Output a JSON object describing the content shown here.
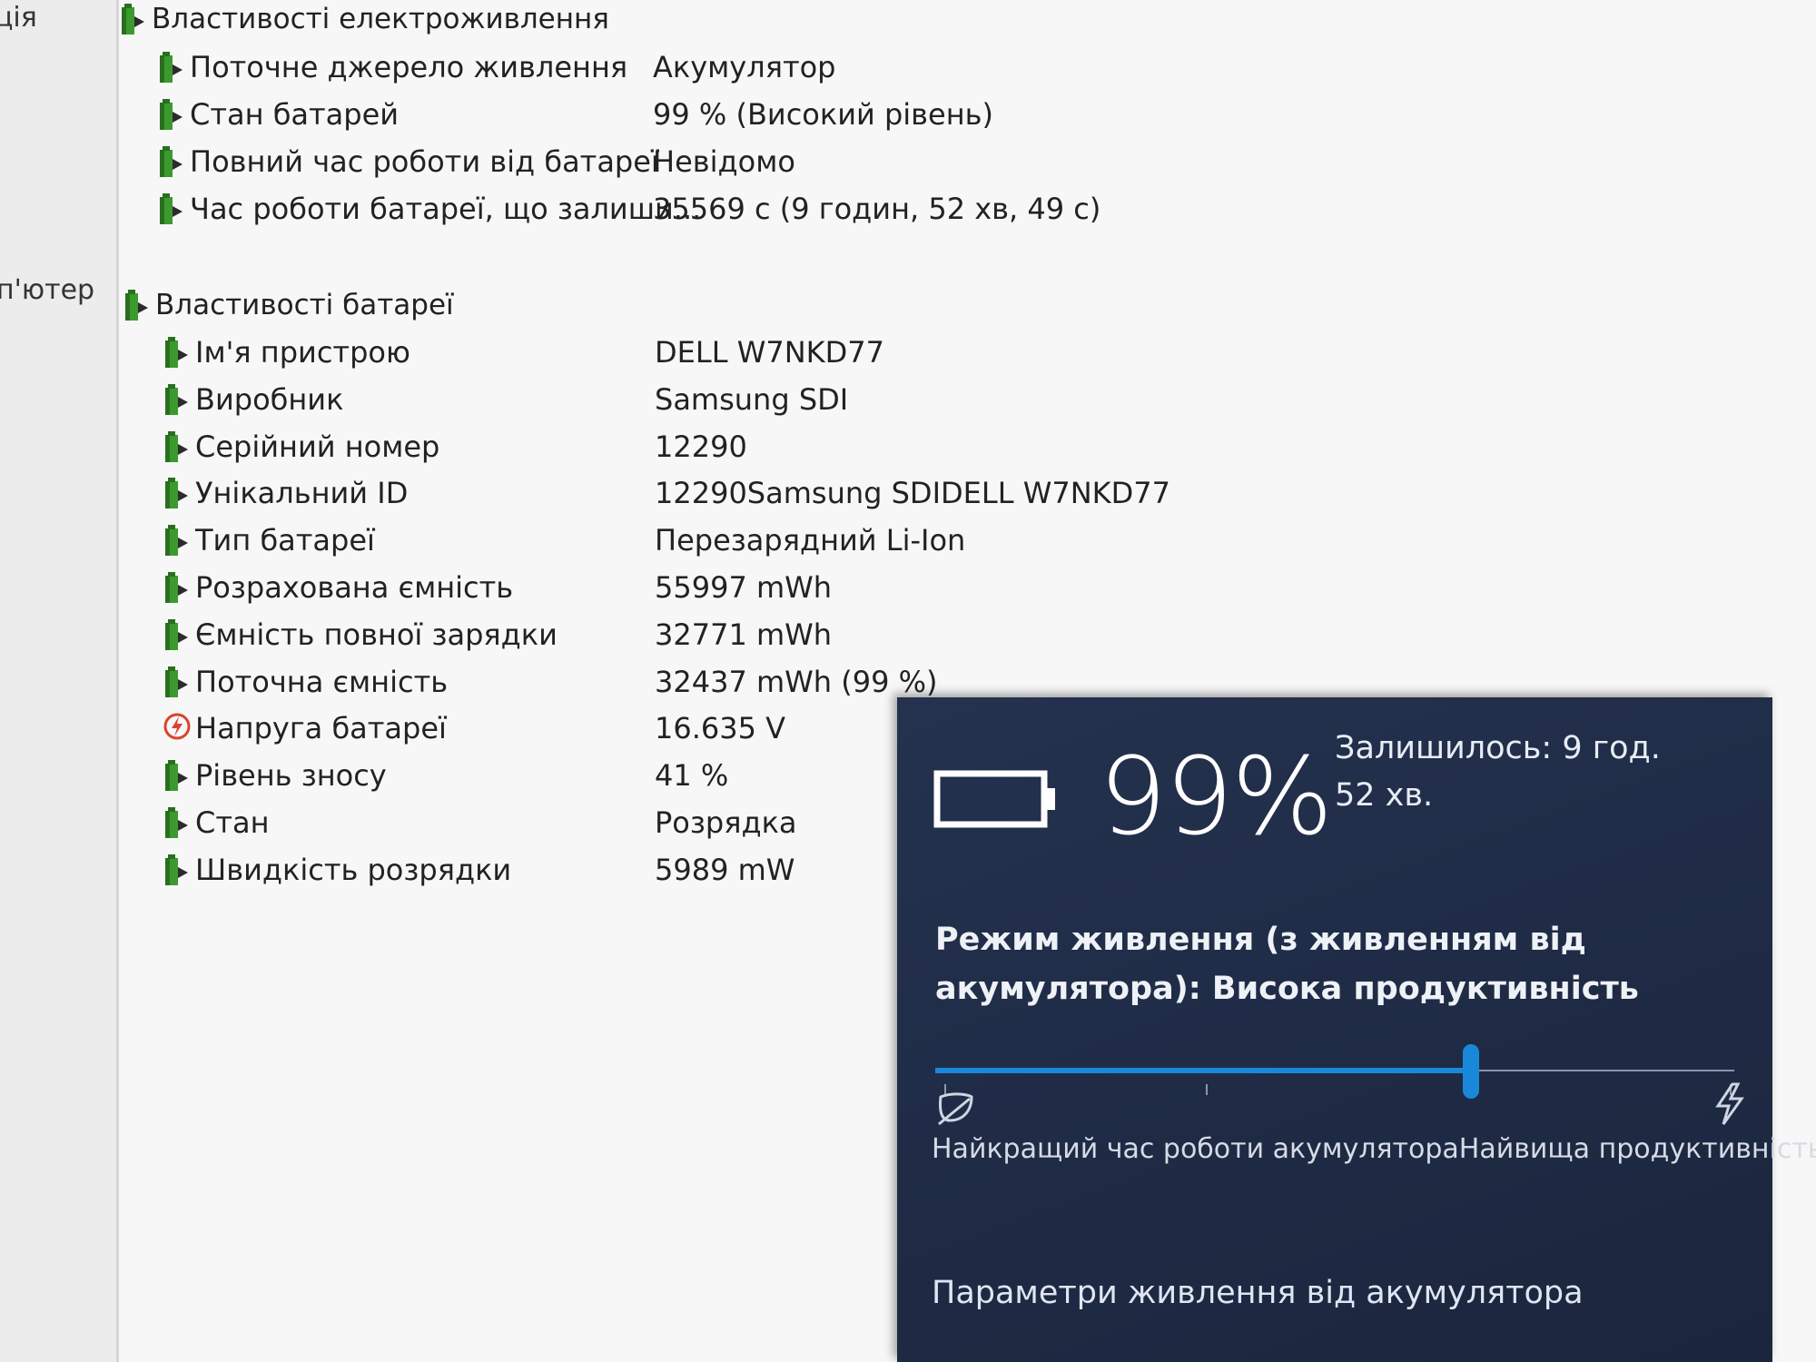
{
  "left_pane": {
    "items": [
      "ція",
      "п'ютер"
    ]
  },
  "power_section": {
    "title": "Властивості електроживлення",
    "rows": [
      {
        "label": "Поточне джерело живлення",
        "value": "Акумулятор"
      },
      {
        "label": "Стан батарей",
        "value": "99 % (Високий рівень)"
      },
      {
        "label": "Повний час роботи від батареї",
        "value": "Невідомо"
      },
      {
        "label": "Час роботи батареї, що залиши...",
        "value": "35569 с (9 годин, 52 хв, 49 с)"
      }
    ]
  },
  "battery_section": {
    "title": "Властивості батареї",
    "rows": [
      {
        "label": "Ім'я пристрою",
        "value": "DELL W7NKD77",
        "icon": "battery-icon"
      },
      {
        "label": "Виробник",
        "value": "Samsung SDI",
        "icon": "battery-icon"
      },
      {
        "label": "Серійний номер",
        "value": "12290",
        "icon": "battery-icon"
      },
      {
        "label": "Унікальний ID",
        "value": "12290Samsung SDIDELL W7NKD77",
        "icon": "battery-icon"
      },
      {
        "label": "Тип батареї",
        "value": "Перезарядний Li-Ion",
        "icon": "battery-icon"
      },
      {
        "label": "Розрахована ємність",
        "value": "55997 mWh",
        "icon": "battery-icon"
      },
      {
        "label": "Ємність повної зарядки",
        "value": "32771 mWh",
        "icon": "battery-icon"
      },
      {
        "label": "Поточна ємність",
        "value": "32437 mWh  (99 %)",
        "icon": "battery-icon"
      },
      {
        "label": "Напруга батареї",
        "value": "16.635 V",
        "icon": "voltage-icon"
      },
      {
        "label": "Рівень зносу",
        "value": "41 %",
        "icon": "battery-icon"
      },
      {
        "label": "Стан",
        "value": "Розрядка",
        "icon": "battery-icon"
      },
      {
        "label": "Швидкість розрядки",
        "value": "5989 mW",
        "icon": "battery-icon"
      }
    ]
  },
  "flyout": {
    "percent": "99%",
    "remaining": "Залишилось: 9 год. 52 хв.",
    "mode_label": "Режим живлення (з живленням від акумулятора): Висока продуктивність",
    "slider_position": 0.67,
    "left_end_label": "Найкращий час роботи акумулятора",
    "right_end_label": "Найвища продуктивність",
    "settings_link": "Параметри живлення від акумулятора"
  },
  "colors": {
    "accent": "#1a88d8",
    "flyout_bg": "#222e4a",
    "icon_green": "#3b9a2e"
  }
}
